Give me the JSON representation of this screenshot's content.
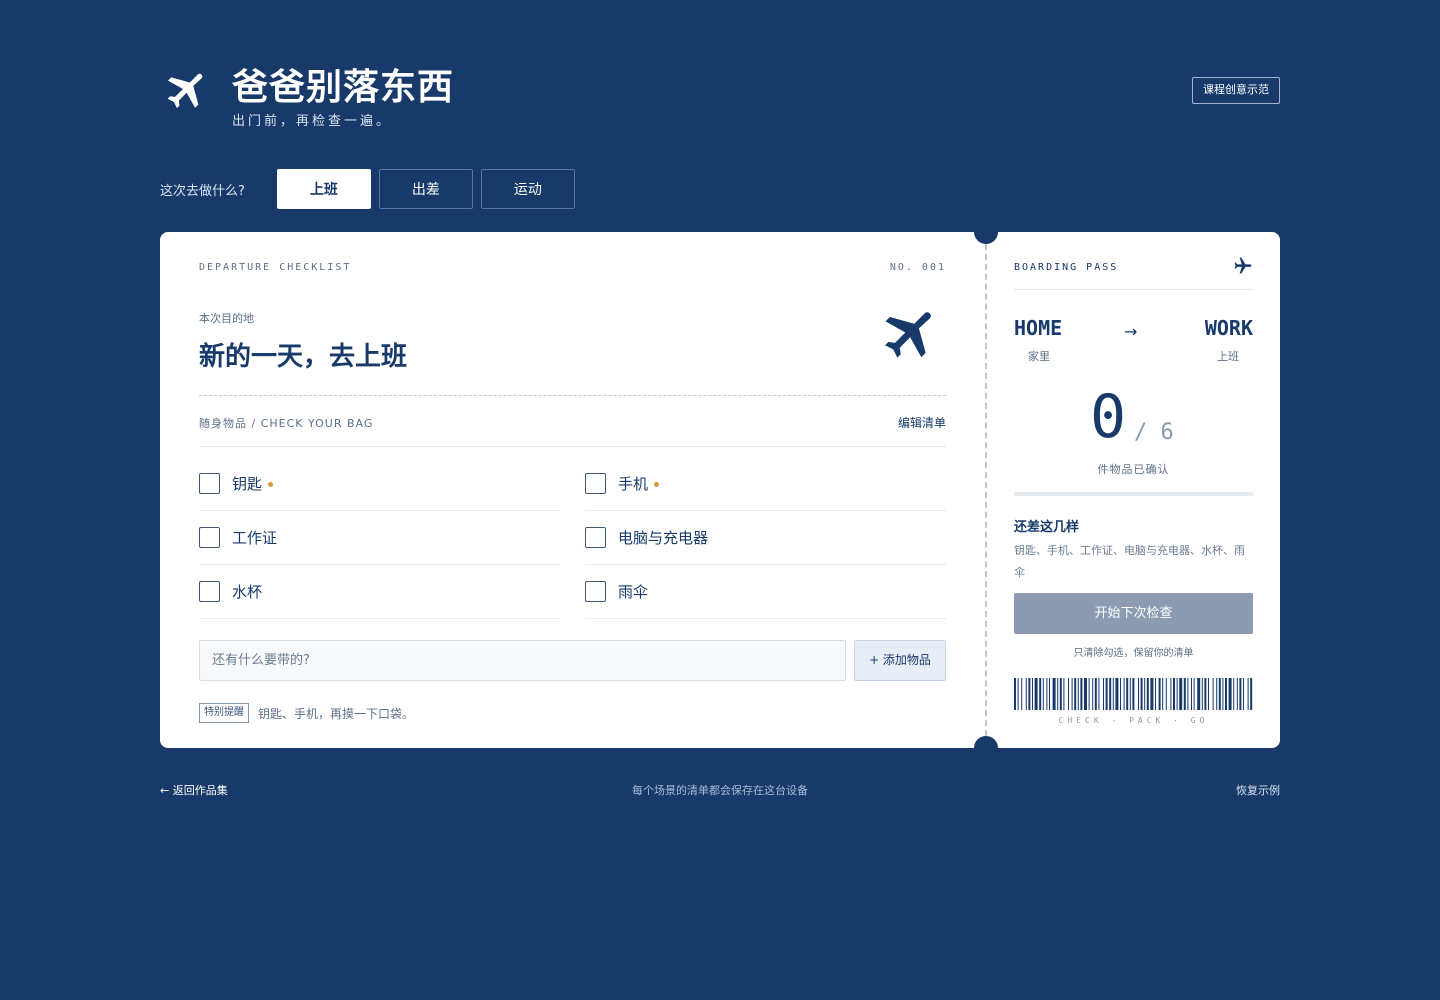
{
  "header": {
    "title": "爸爸别落东西",
    "subtitle": "出门前，再检查一遍。",
    "demo_button": "课程创意示范",
    "logo_icon": "airplane-icon"
  },
  "scene": {
    "label": "这次去做什么?",
    "options": [
      "上班",
      "出差",
      "运动"
    ],
    "selected": "上班"
  },
  "checklist": {
    "kicker": "DEPARTURE CHECKLIST",
    "number": "NO. 001",
    "destination_label": "本次目的地",
    "destination_title": "新的一天，去上班",
    "bag_label": "随身物品 / CHECK YOUR BAG",
    "edit_label": "编辑清单",
    "items": [
      {
        "label": "钥匙",
        "checked": false,
        "important": true
      },
      {
        "label": "手机",
        "checked": false,
        "important": true
      },
      {
        "label": "工作证",
        "checked": false,
        "important": false
      },
      {
        "label": "电脑与充电器",
        "checked": false,
        "important": false
      },
      {
        "label": "水杯",
        "checked": false,
        "important": false
      },
      {
        "label": "雨伞",
        "checked": false,
        "important": false
      }
    ],
    "add_placeholder": "还有什么要带的?",
    "add_button": "+ 添加物品",
    "tip_badge": "特别提醒",
    "tip_text": "钥匙、手机，再摸一下口袋。"
  },
  "pass": {
    "kicker": "BOARDING PASS",
    "from": "HOME",
    "from_cn": "家里",
    "arrow": "→",
    "to": "WORK",
    "to_cn": "上班",
    "done": "0",
    "total": "/ 6",
    "progress": 0,
    "count_caption": "件物品已确认",
    "remain_title": "还差这几样",
    "remain_text": "钥匙、手机、工作证、电脑与充电器、水杯、雨伞",
    "next_button": "开始下次检查",
    "next_caption": "只清除勾选，保留你的清单",
    "barcode_caption": "CHECK · PACK · GO"
  },
  "footer": {
    "back": "← 返回作品集",
    "note": "每个场景的清单都会保存在这台设备",
    "restore": "恢复示例"
  },
  "colors": {
    "background": "#173a6a",
    "card": "#ffffff",
    "accent_dot": "#d69a3c",
    "button_disabled": "#8c9bb1"
  }
}
